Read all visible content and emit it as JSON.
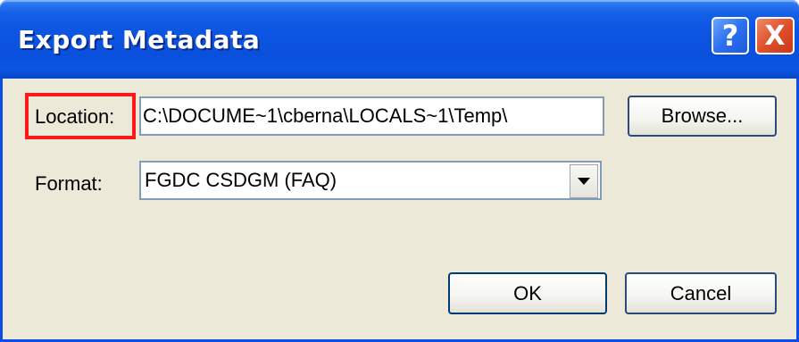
{
  "dialog": {
    "title": "Export Metadata",
    "help_label": "?",
    "close_label": "X"
  },
  "location": {
    "label": "Location:",
    "value": "C:\\DOCUME~1\\cberna\\LOCALS~1\\Temp\\"
  },
  "format": {
    "label": "Format:",
    "selected": "FGDC CSDGM (FAQ)"
  },
  "buttons": {
    "browse": "Browse...",
    "ok": "OK",
    "cancel": "Cancel"
  },
  "colors": {
    "highlight": "#ff1a1a",
    "titlebar": "#0a50dc"
  }
}
